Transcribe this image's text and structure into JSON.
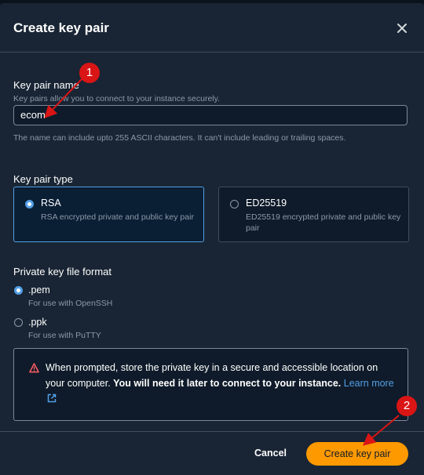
{
  "modal": {
    "title": "Create key pair",
    "close_icon": "close-icon"
  },
  "key_name": {
    "label": "Key pair name",
    "description": "Key pairs allow you to connect to your instance securely.",
    "value": "ecom",
    "constraint": "The name can include upto 255 ASCII characters. It can't include leading or trailing spaces."
  },
  "key_type": {
    "label": "Key pair type",
    "options": [
      {
        "title": "RSA",
        "description": "RSA encrypted private and public key pair",
        "selected": true
      },
      {
        "title": "ED25519",
        "description": "ED25519 encrypted private and public key pair",
        "selected": false
      }
    ]
  },
  "file_format": {
    "label": "Private key file format",
    "options": [
      {
        "title": ".pem",
        "description": "For use with OpenSSH",
        "selected": true
      },
      {
        "title": ".ppk",
        "description": "For use with PuTTY",
        "selected": false
      }
    ]
  },
  "alert": {
    "icon": "warning-icon",
    "text": "When prompted, store the private key in a secure and accessible location on your computer.",
    "bold": "You will need it later to connect to your instance.",
    "link": "Learn more",
    "link_icon": "external-link-icon"
  },
  "footer": {
    "cancel_label": "Cancel",
    "create_label": "Create key pair"
  },
  "annotations": {
    "badge_1": "1",
    "badge_2": "2",
    "color": "#d91515"
  },
  "colors": {
    "background": "#192534",
    "accent": "#539fe5",
    "primary_button": "#ff9900"
  }
}
